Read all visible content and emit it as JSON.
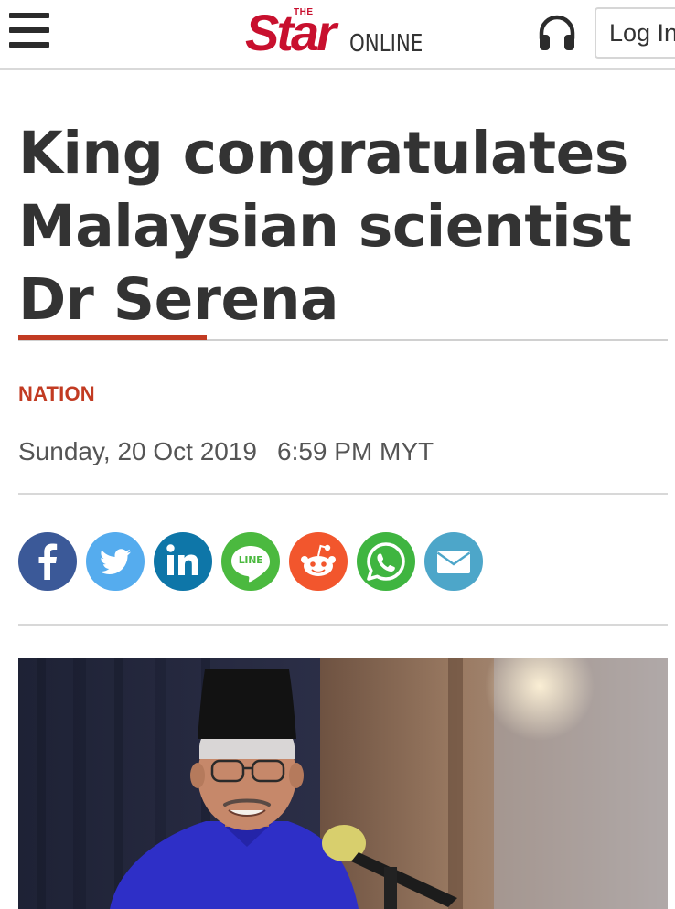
{
  "header": {
    "menu_icon": "hamburger-menu-icon",
    "logo": {
      "the": "THE",
      "star": "Star",
      "online": "ONLINE"
    },
    "audio_icon": "headphones-icon",
    "login_label": "Log In"
  },
  "article": {
    "title_lines": [
      "King congratulates",
      "Malaysian scientist",
      "Dr Serena"
    ],
    "category": "NATION",
    "date": "Sunday, 20 Oct 2019",
    "time": "6:59 PM MYT"
  },
  "share": [
    {
      "name": "facebook-icon",
      "color": "#3b5998"
    },
    {
      "name": "twitter-icon",
      "color": "#55acee"
    },
    {
      "name": "linkedin-icon",
      "color": "#0e76a8"
    },
    {
      "name": "line-icon",
      "color": "#4bb93f",
      "label": "LINE"
    },
    {
      "name": "reddit-icon",
      "color": "#f2562d"
    },
    {
      "name": "whatsapp-icon",
      "color": "#3fb540"
    },
    {
      "name": "email-icon",
      "color": "#4da6c9"
    }
  ],
  "colors": {
    "brand_red": "#c8102e",
    "accent_red": "#c23b22",
    "text": "#333333"
  }
}
